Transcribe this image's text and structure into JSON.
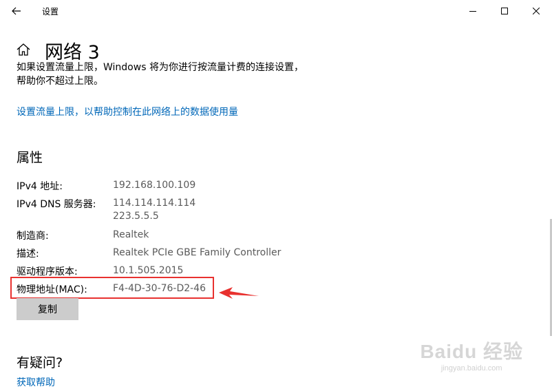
{
  "window": {
    "title": "设置",
    "back_icon": "arrow-left-icon",
    "minimize_icon": "minimize-icon",
    "maximize_icon": "maximize-icon",
    "close_icon": "close-icon"
  },
  "header": {
    "home_icon": "home-icon",
    "title": "网络 3"
  },
  "metered": {
    "text_line1": "如果设置流量上限，Windows 将为你进行按流量计费的连接设置，",
    "text_line2": "帮助你不超过上限。",
    "link": "设置流量上限，以帮助控制在此网络上的数据使用量"
  },
  "properties": {
    "title": "属性",
    "rows": [
      {
        "label": "IPv4 地址:",
        "value": "192.168.100.109"
      },
      {
        "label": "IPv4 DNS 服务器:",
        "value": "114.114.114.114",
        "value2": "223.5.5.5"
      },
      {
        "label": "制造商:",
        "value": "Realtek"
      },
      {
        "label": "描述:",
        "value": "Realtek PCIe GBE Family Controller"
      },
      {
        "label": "驱动程序版本:",
        "value": "10.1.505.2015"
      },
      {
        "label": "物理地址(MAC):",
        "value": "F4-4D-30-76-D2-46"
      }
    ],
    "copy_button": "复制"
  },
  "help": {
    "title": "有疑问?",
    "link": "获取帮助"
  },
  "annotation": {
    "color": "#e8312f"
  },
  "watermark": {
    "logo": "Baidu 经验",
    "url": "jingyan.baidu.com"
  },
  "colors": {
    "link": "#0067b8",
    "value_text": "#5a5a5a",
    "button_bg": "#cccccc"
  }
}
